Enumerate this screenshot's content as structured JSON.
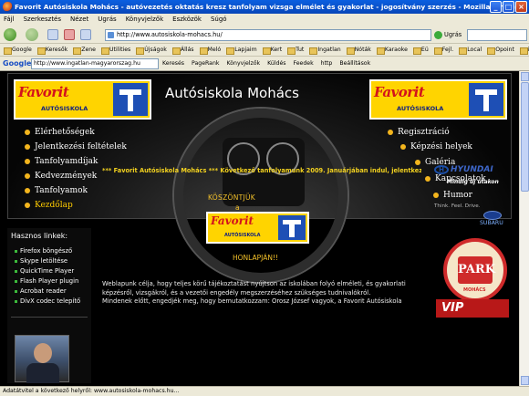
{
  "window": {
    "title": "Favorit Autósiskola Mohács - autóvezetés oktatás kresz tanfolyam vizsga elmélet és gyakorlat - jogosítvány szerzés - Mozilla Firefox",
    "minimize": "_",
    "maximize": "□",
    "close": "×"
  },
  "menu": [
    "Fájl",
    "Szerkesztés",
    "Nézet",
    "Ugrás",
    "Könyvjelzők",
    "Eszközök",
    "Súgó"
  ],
  "navbar": {
    "url": "http://www.autosiskola-mohacs.hu/",
    "go_label": "Ugrás"
  },
  "bookmarks": [
    "Google",
    "Keresők",
    "Zene",
    "Utilities",
    "Újságok",
    "Állás",
    "Meló",
    "Lapjaim",
    "Kert",
    "Tut",
    "Ingatlan",
    "Nóták",
    "Karaoke",
    "Eü",
    "Fejl.",
    "Local",
    "Opoint",
    "ingb"
  ],
  "google_toolbar": {
    "logo": "Google",
    "search_value": "http://www.ingatlan-magyarorszag.hu",
    "items": [
      "Keresés",
      "PageRank",
      "Könyvjelzők",
      "Küldés",
      "Feedek",
      "http",
      "Beállítások"
    ]
  },
  "header": {
    "logo_favorit": "Favorit",
    "logo_sub": "AUTÓSISKOLA",
    "site_title": "Autósiskola Mohács"
  },
  "nav_left": [
    {
      "label": "Elérhetőségek",
      "active": false
    },
    {
      "label": "Jelentkezési feltételek",
      "active": false
    },
    {
      "label": "Tanfolyamdíjak",
      "active": false
    },
    {
      "label": "Kedvezmények",
      "active": false
    },
    {
      "label": "Tanfolyamok",
      "active": false
    },
    {
      "label": "Kezdőlap",
      "active": true
    }
  ],
  "nav_right": [
    {
      "label": "Regisztráció"
    },
    {
      "label": "Képzési helyek"
    },
    {
      "label": "Galéria"
    },
    {
      "label": "Kapcsolatok"
    },
    {
      "label": "Humor"
    }
  ],
  "sidebar": {
    "heading": "Hasznos linkek:",
    "links": [
      "Firefox böngésző",
      "Skype letöltése",
      "QuickTime Player",
      "Flash Player plugin",
      "Acrobat reader",
      "DivX codec telepítő"
    ]
  },
  "main": {
    "marquee": "*** Favorit Autósiskola Mohács *** Következő tanfolyamunk 2009. Januárjában indul, jelentkezési",
    "welcome_line1": "KÖSZÖNTJÜK",
    "welcome_line2": "a",
    "welcome_line3": "HONLAPJÁN!!",
    "body": "Weblapunk célja, hogy teljes körű tájékoztatást nyújtson az iskolában folyó elméleti, és gyakorlati képzésről, vizsgákról, és a vezetői engedély megszerzéséhez szükséges tudnivalókról.",
    "body2": "Mindenek előtt, engedjék meg, hogy bemutatkozzam: Orosz József vagyok, a Favorit Autósiskola"
  },
  "ads": {
    "hyundai_word": "HYUNDAI",
    "hyundai_slogan": "Mindig új utakon",
    "subaru_think": "Think. Feel. Drive.",
    "subaru_word": "SUBARU",
    "park_text": "PARK",
    "park_sub": "MOHÁCS",
    "vaio_text": "VIP"
  },
  "status": "Adatátvitel a következő helyről: www.autosiskola-mohacs.hu...",
  "colors": {
    "titlebar": "#0846b8",
    "page_bg": "#000000",
    "accent_yellow": "#f2c02a",
    "logo_yellow": "#ffd400",
    "logo_red": "#d3121c",
    "logo_blue": "#1e4fb5"
  }
}
